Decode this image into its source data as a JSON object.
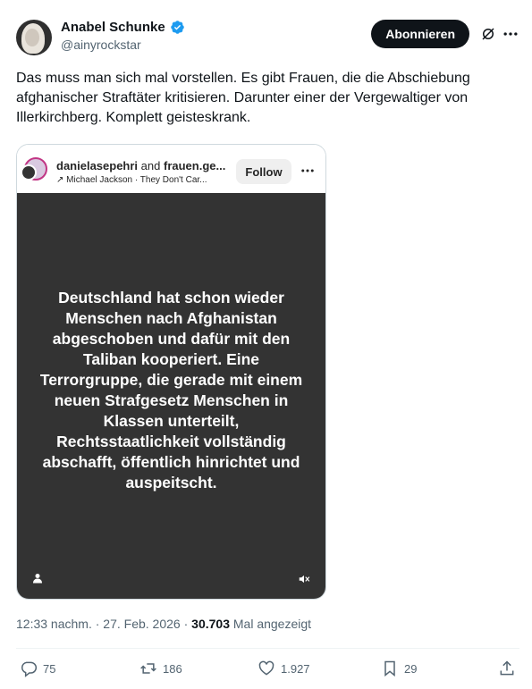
{
  "author": {
    "display_name": "Anabel Schunke",
    "handle": "@ainyrockstar"
  },
  "header": {
    "follow_label": "Abonnieren"
  },
  "tweet": {
    "text": "Das muss man sich mal vorstellen. Es gibt Frauen, die die Abschiebung afghanischer Straftäter kritisieren. Darunter einer der Vergewaltiger von Illerkirchberg. Komplett geisteskrank."
  },
  "embed": {
    "user_primary": "danielasepehri",
    "user_conj": "and",
    "user_secondary": "frauen.ge...",
    "music": "↗ Michael Jackson · They Don't Car...",
    "follow_label": "Follow",
    "story_text": "Deutschland hat schon wieder Menschen nach Afghanistan abgeschoben und dafür mit den Taliban kooperiert. Eine Terrorgruppe, die gerade mit einem neuen Strafgesetz Menschen in Klassen unterteilt, Rechtsstaatlichkeit vollständig abschafft, öffentlich hinrichtet und auspeitscht."
  },
  "meta": {
    "time": "12:33 nachm.",
    "sep1": "·",
    "date": "27. Feb. 2026",
    "sep2": "·",
    "views": "30.703",
    "views_label": "Mal angezeigt"
  },
  "actions": {
    "replies": "75",
    "reposts": "186",
    "likes": "1.927",
    "bookmarks": "29"
  },
  "colors": {
    "accent_verified": "#1d9bf0",
    "text_primary": "#0f1419",
    "text_secondary": "#536471",
    "story_bg": "#333333"
  }
}
